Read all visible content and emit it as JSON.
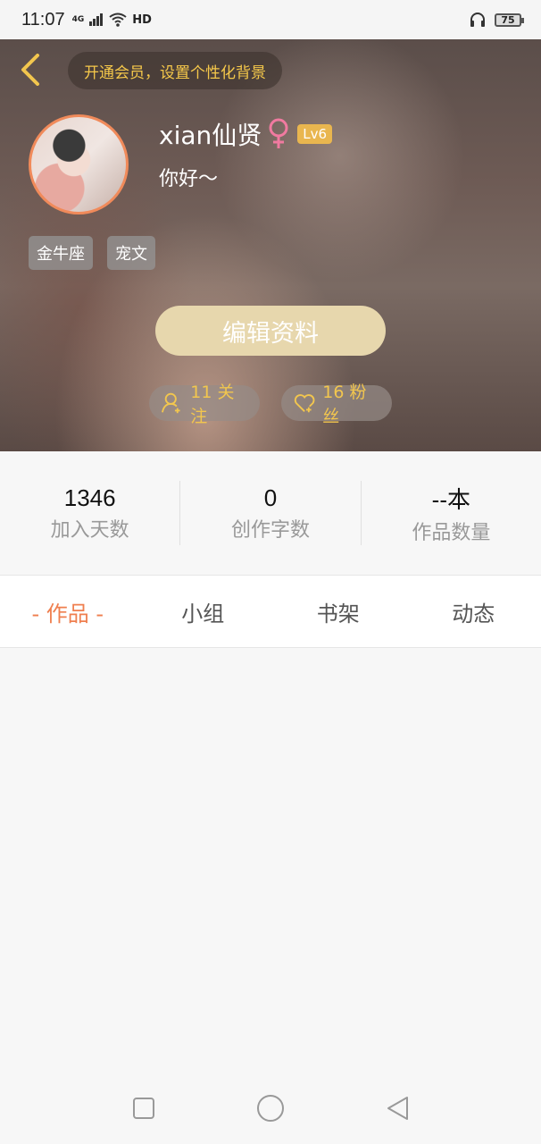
{
  "status_bar": {
    "time": "11:07",
    "network": "4G",
    "hd": "HD",
    "battery": "75",
    "icons": [
      "signal-icon",
      "wifi-icon",
      "headphones-icon",
      "battery-icon"
    ]
  },
  "header": {
    "vip_banner": "开通会员，设置个性化背景",
    "username": "xian仙贤",
    "gender": "female",
    "level": "Lv6",
    "bio": "你好～",
    "tags": [
      "金牛座",
      "宠文"
    ],
    "edit_button": "编辑资料",
    "follow": "11 关注",
    "fans": "16 粉丝",
    "colors": {
      "accent": "#f2c64e",
      "edit_button_bg": "#e7d7ad",
      "gender_pink": "#f07aa0",
      "avatar_border": "#f08a5a"
    }
  },
  "stats": [
    {
      "value": "1346",
      "label": "加入天数"
    },
    {
      "value": "0",
      "label": "创作字数"
    },
    {
      "value": "--本",
      "label": "作品数量"
    }
  ],
  "tabs": [
    {
      "label": "- 作品 -",
      "active": true
    },
    {
      "label": "小组",
      "active": false
    },
    {
      "label": "书架",
      "active": false
    },
    {
      "label": "动态",
      "active": false
    }
  ],
  "nav": [
    "square-icon",
    "circle-icon",
    "triangle-back-icon"
  ],
  "colors": {
    "tab_active": "#ef7f4f"
  }
}
